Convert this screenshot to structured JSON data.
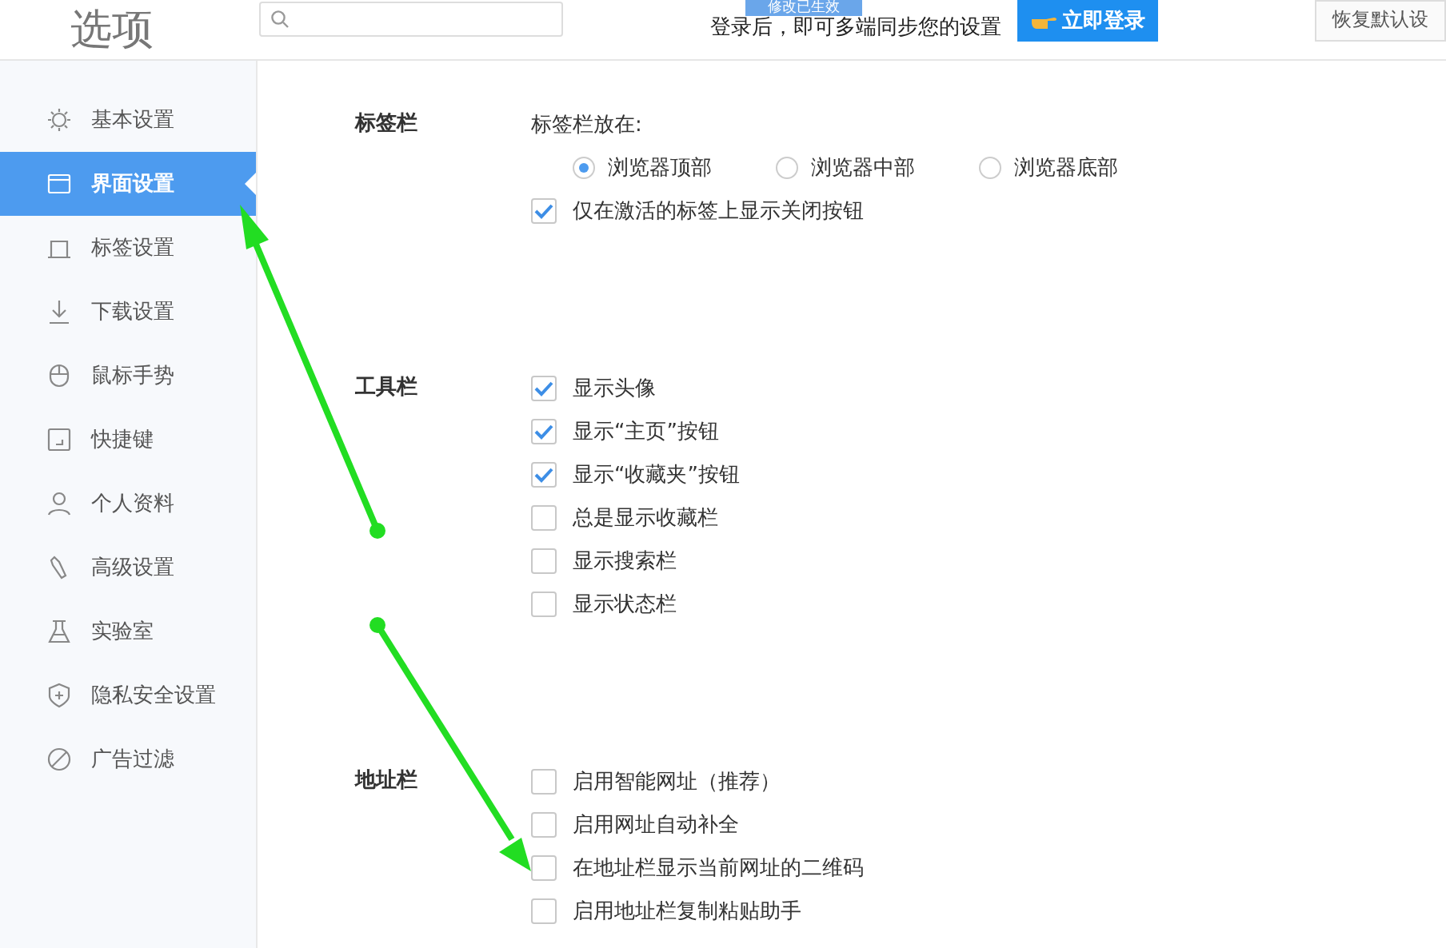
{
  "header": {
    "title": "选项",
    "toast": "修改已生效",
    "login_hint": "登录后，即可多端同步您的设置",
    "login_button": "立即登录",
    "reset_button": "恢复默认设"
  },
  "sidebar": {
    "items": [
      {
        "label": "基本设置",
        "selected": false
      },
      {
        "label": "界面设置",
        "selected": true
      },
      {
        "label": "标签设置",
        "selected": false
      },
      {
        "label": "下载设置",
        "selected": false
      },
      {
        "label": "鼠标手势",
        "selected": false
      },
      {
        "label": "快捷键",
        "selected": false
      },
      {
        "label": "个人资料",
        "selected": false
      },
      {
        "label": "高级设置",
        "selected": false
      },
      {
        "label": "实验室",
        "selected": false
      },
      {
        "label": "隐私安全设置",
        "selected": false
      },
      {
        "label": "广告过滤",
        "selected": false
      }
    ]
  },
  "sections": [
    {
      "title": "标签栏",
      "items": [
        {
          "kind": "text",
          "label": "标签栏放在:"
        },
        {
          "kind": "radios",
          "options": [
            {
              "label": "浏览器顶部",
              "selected": true
            },
            {
              "label": "浏览器中部",
              "selected": false
            },
            {
              "label": "浏览器底部",
              "selected": false
            }
          ]
        },
        {
          "kind": "checkbox",
          "label": "仅在激活的标签上显示关闭按钮",
          "checked": true
        }
      ]
    },
    {
      "title": "工具栏",
      "items": [
        {
          "kind": "checkbox",
          "label": "显示头像",
          "checked": true
        },
        {
          "kind": "checkbox",
          "label": "显示“主页”按钮",
          "checked": true
        },
        {
          "kind": "checkbox",
          "label": "显示“收藏夹”按钮",
          "checked": true
        },
        {
          "kind": "checkbox",
          "label": "总是显示收藏栏",
          "checked": false
        },
        {
          "kind": "checkbox",
          "label": "显示搜索栏",
          "checked": false
        },
        {
          "kind": "checkbox",
          "label": "显示状态栏",
          "checked": false
        }
      ]
    },
    {
      "title": "地址栏",
      "items": [
        {
          "kind": "checkbox",
          "label": "启用智能网址（推荐）",
          "checked": false
        },
        {
          "kind": "checkbox",
          "label": "启用网址自动补全",
          "checked": false
        },
        {
          "kind": "checkbox",
          "label": "在地址栏显示当前网址的二维码",
          "checked": false
        },
        {
          "kind": "checkbox",
          "label": "启用地址栏复制粘贴助手",
          "checked": false
        }
      ]
    }
  ]
}
